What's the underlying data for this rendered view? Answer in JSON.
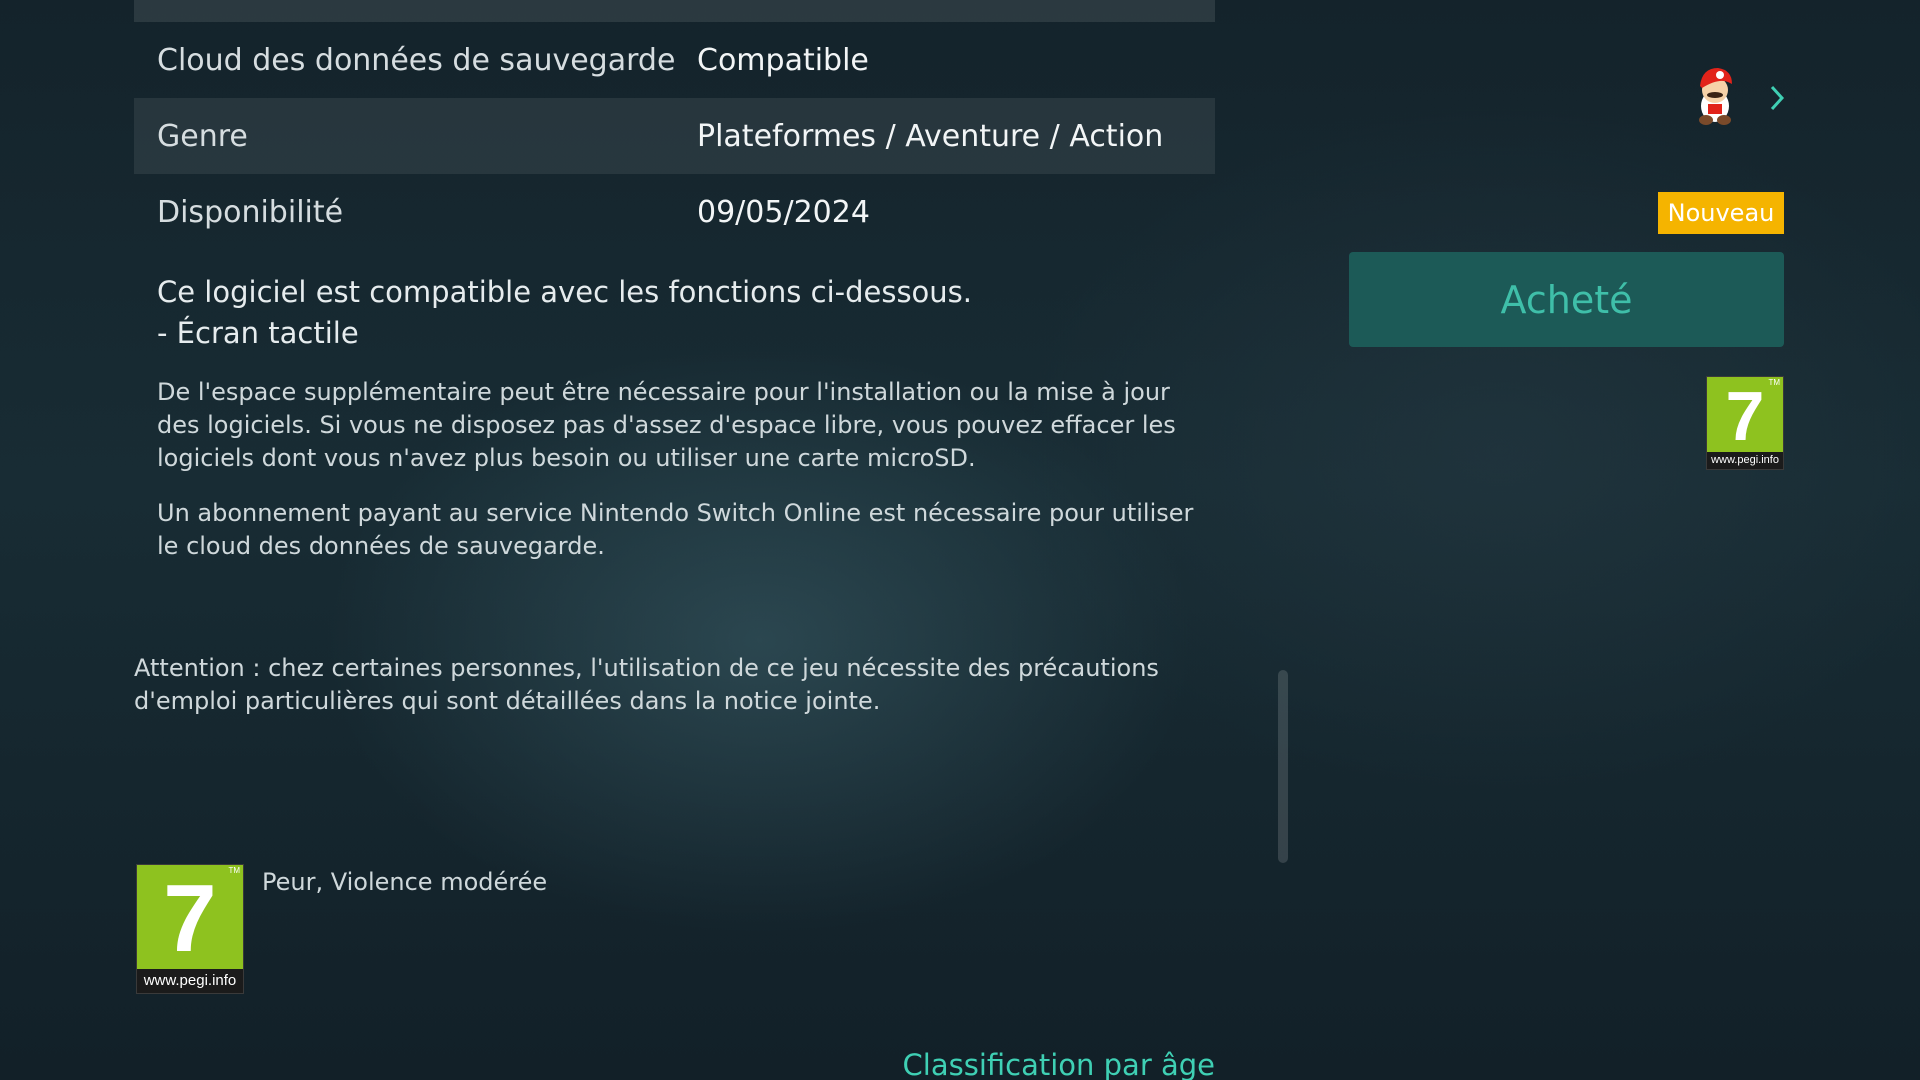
{
  "details": {
    "rows": [
      {
        "label": "Cloud des données de sauvegarde",
        "value": "Compatible"
      },
      {
        "label": "Genre",
        "value": "Plateformes / Aventure / Action"
      },
      {
        "label": "Disponibilité",
        "value": "09/05/2024"
      }
    ],
    "features_intro": "Ce logiciel est compatible avec les fonctions ci-dessous.",
    "features": [
      "- Écran tactile"
    ],
    "storage_note": "De l'espace supplémentaire peut être nécessaire pour l'installation ou la mise à jour des logiciels. Si vous ne disposez pas d'assez d'espace libre, vous pouvez effacer les logiciels dont vous n'avez plus besoin ou utiliser une carte microSD.",
    "online_note": "Un abonnement payant au service Nintendo Switch Online est nécessaire pour utiliser le cloud des données de sauvegarde.",
    "warning": "Attention : chez certaines personnes, l'utilisation de ce jeu nécessite des précautions d'emploi particulières qui sont détaillées dans la notice jointe."
  },
  "rating": {
    "pegi_number": "7",
    "pegi_url": "www.pegi.info",
    "tm": "TM",
    "descriptors": "Peur, Violence modérée",
    "classification_link": "Classification par âge"
  },
  "sidebar": {
    "badge": "Nouveau",
    "buy_button": "Acheté",
    "avatar_icon": "mario-avatar-icon",
    "chevron_icon": "chevron-right-icon"
  },
  "colors": {
    "accent": "#3fd0b4",
    "badge": "#f5b400",
    "button_bg": "#1c5a57",
    "pegi_green": "#8ec21f"
  }
}
